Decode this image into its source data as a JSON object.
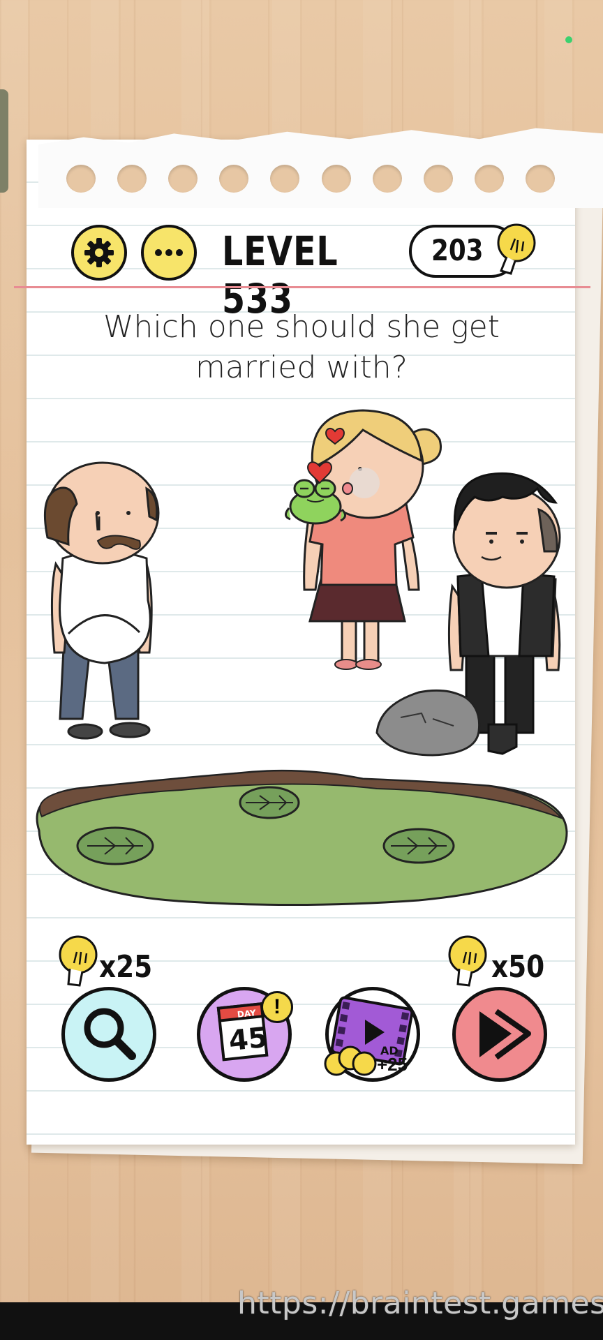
{
  "header": {
    "settings_icon": "gear-icon",
    "menu_icon": "more-dots-icon",
    "level_title": "LEVEL 533",
    "hint_count": "203",
    "hint_icon": "lightbulb-icon"
  },
  "question": "Which one should she get married with?",
  "scene": {
    "characters": [
      "old-man",
      "girl-with-frog",
      "young-man"
    ],
    "props": [
      "frog-icon",
      "rock",
      "pond",
      "lily-pads"
    ]
  },
  "tools": {
    "hint_cost_label": "x25",
    "skip_cost_label": "x50",
    "daily_day_label": "DAY",
    "daily_day_number": "45",
    "daily_badge": "!",
    "ad_label": "AD",
    "ad_reward": "+25"
  },
  "footer": {
    "url": "https://braintest.games"
  },
  "colors": {
    "accent_yellow": "#f7e46a",
    "hint_button": "#c9f3f5",
    "daily_button": "#d8a6f0",
    "skip_button": "#f08a8e",
    "pond": "#96b96e",
    "red_margin": "#e88c93"
  }
}
